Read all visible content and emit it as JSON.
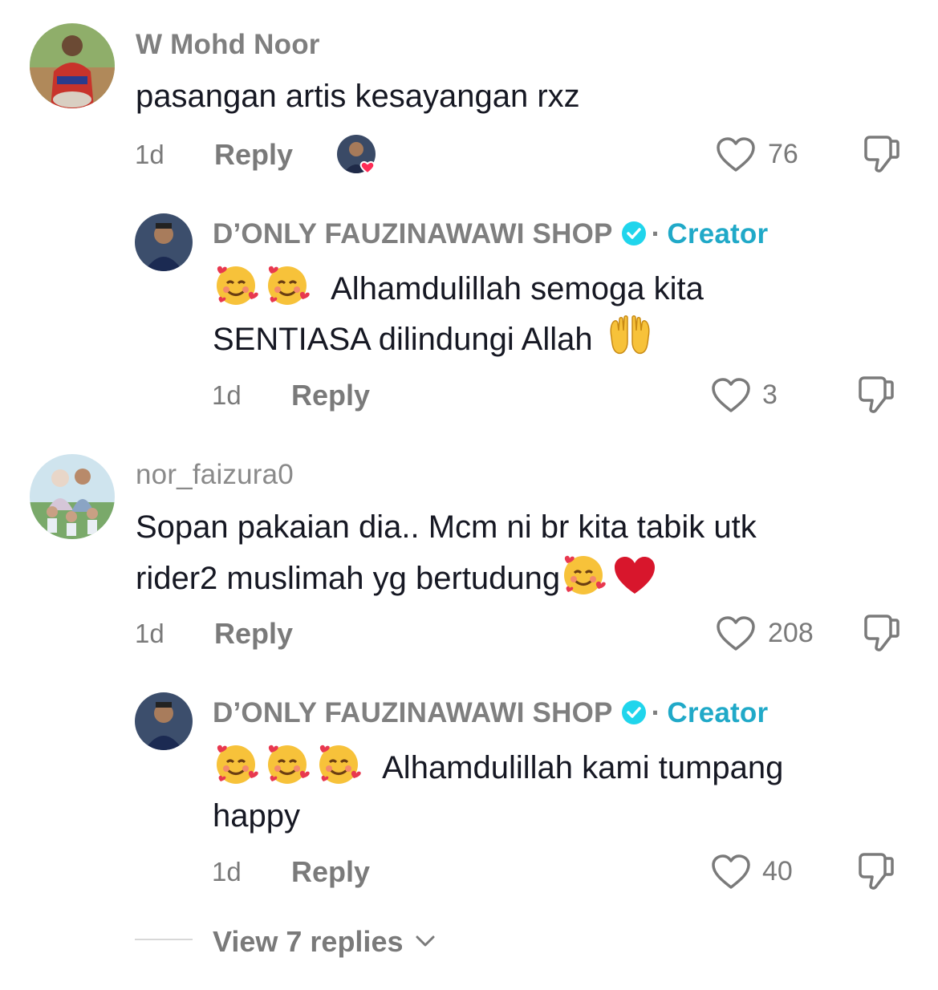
{
  "comments": [
    {
      "username": "W Mohd Noor",
      "text": "pasangan artis kesayangan rxz",
      "time": "1d",
      "reply_label": "Reply",
      "likes": "76",
      "reply": {
        "username": "D’ONLY FAUZINAWAWI SHOP",
        "badge": "Creator",
        "line1": "Alhamdulillah semoga kita",
        "line2": "SENTIASA dilindungi Allah",
        "time": "1d",
        "reply_label": "Reply",
        "likes": "3"
      }
    },
    {
      "username": "nor_faizura0",
      "line1": "Sopan pakaian dia.. Mcm ni br kita tabik utk",
      "line2": "rider2 muslimah yg bertudung",
      "time": "1d",
      "reply_label": "Reply",
      "likes": "208",
      "reply": {
        "username": "D’ONLY FAUZINAWAWI SHOP",
        "badge": "Creator",
        "line1": "Alhamdulillah kami tumpang",
        "line2": "happy",
        "time": "1d",
        "reply_label": "Reply",
        "likes": "40"
      }
    }
  ],
  "view_more": "View 7 replies",
  "colors": {
    "accent": "#20a9c8",
    "verified": "#20d5ec",
    "muted": "#7a7a7a"
  },
  "icons": [
    "heart-outline-icon",
    "dislike-icon",
    "verified-icon",
    "chevron-down-icon"
  ]
}
